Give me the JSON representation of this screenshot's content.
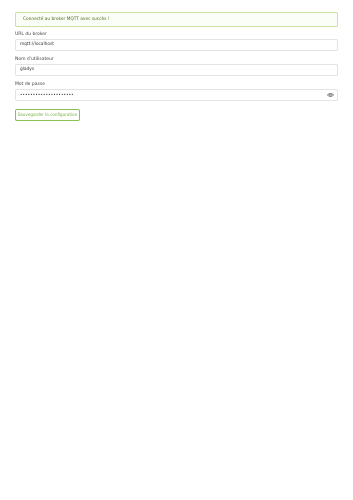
{
  "status": {
    "message": "Connecté au broker MQTT avec succès !",
    "color": "#8cc152"
  },
  "form": {
    "broker_url": {
      "label": "URL du broker",
      "value": "mqtt://localhost"
    },
    "username": {
      "label": "Nom d'utilisateur",
      "value": "gladys"
    },
    "password": {
      "label": "Mot de passe",
      "value": "•••••••••••••••••••••",
      "toggle_icon": "eye-icon"
    },
    "save_label": "Sauvegarder la configuration"
  }
}
